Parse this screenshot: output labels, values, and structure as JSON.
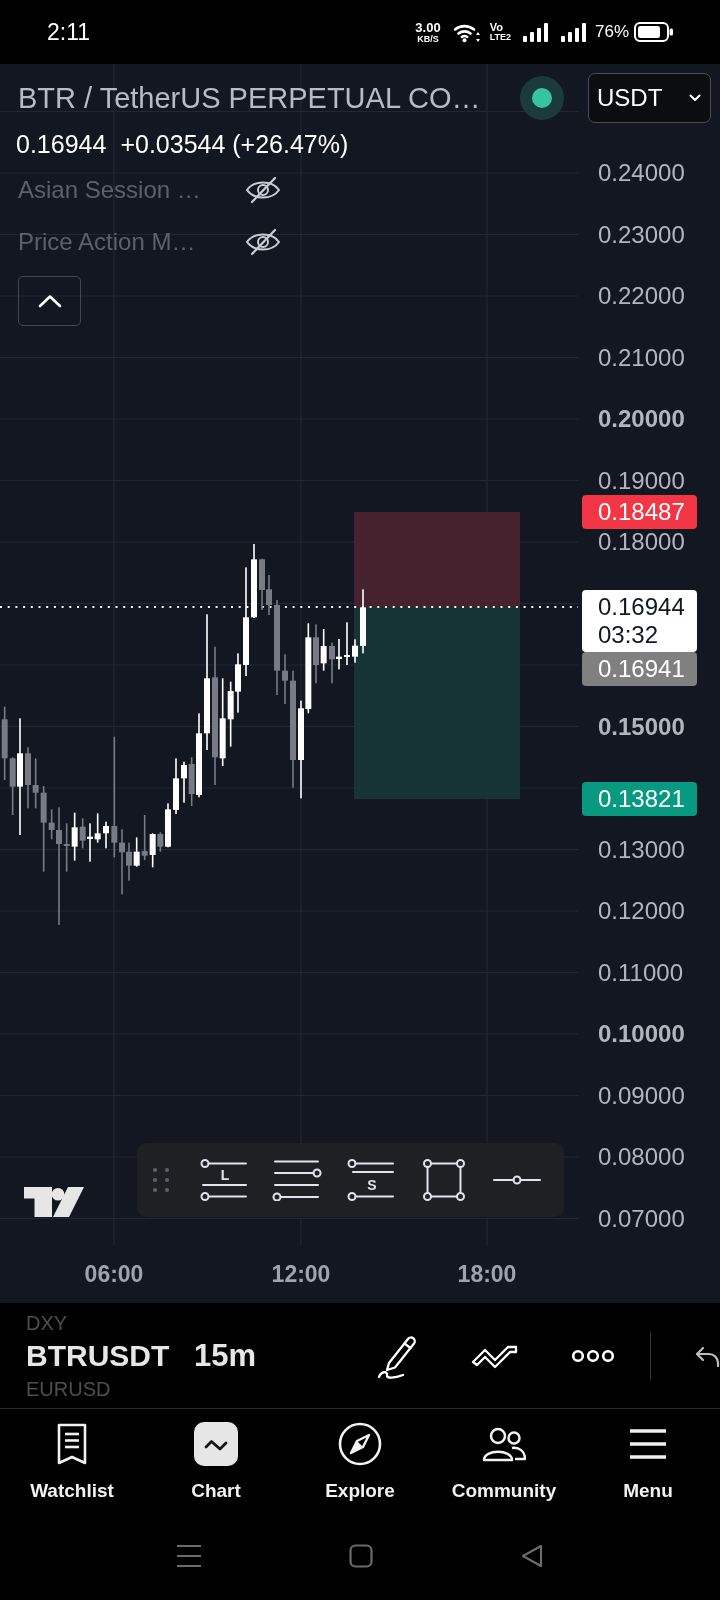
{
  "status_bar": {
    "time": "2:11",
    "speed": {
      "value": "3.00",
      "unit": "KB/S"
    },
    "network": {
      "top": "Vo",
      "bottom": "LTE2"
    },
    "battery": "76%"
  },
  "header": {
    "title": "BTR / TetherUS PERPETUAL CO…",
    "market_open": true,
    "currency": "USDT"
  },
  "quote": {
    "price": "0.16944",
    "change": "+0.03544 (+26.47%)"
  },
  "indicators": [
    {
      "name": "Asian Session …",
      "visible": false
    },
    {
      "name": "Price Action M…",
      "visible": false
    }
  ],
  "price_scale": [
    {
      "label": "0.24000",
      "bold": false
    },
    {
      "label": "0.23000",
      "bold": false
    },
    {
      "label": "0.22000",
      "bold": false
    },
    {
      "label": "0.21000",
      "bold": false
    },
    {
      "label": "0.20000",
      "bold": true
    },
    {
      "label": "0.19000",
      "bold": false
    },
    {
      "label": "0.18000",
      "bold": false
    },
    {
      "label": "0.15000",
      "bold": true
    },
    {
      "label": "0.13000",
      "bold": false
    },
    {
      "label": "0.12000",
      "bold": false
    },
    {
      "label": "0.11000",
      "bold": false
    },
    {
      "label": "0.10000",
      "bold": true
    },
    {
      "label": "0.09000",
      "bold": false
    },
    {
      "label": "0.08000",
      "bold": false
    },
    {
      "label": "0.07000",
      "bold": false
    }
  ],
  "price_markers": [
    {
      "value": "0.18487",
      "color": "#f23645"
    },
    {
      "value": "0.16944",
      "countdown": "03:32",
      "color": "#ffffff"
    },
    {
      "value": "0.16941",
      "color": "#808080"
    },
    {
      "value": "0.13821",
      "color": "#089981"
    }
  ],
  "time_scale": [
    "06:00",
    "12:00",
    "18:00"
  ],
  "drawing_toolbar": [
    {
      "kind": "long-position",
      "label": "L"
    },
    {
      "kind": "parallel-lines"
    },
    {
      "kind": "short-position",
      "label": "S"
    },
    {
      "kind": "rectangle"
    },
    {
      "kind": "horizontal-line"
    }
  ],
  "symbol_bar": {
    "symbols": [
      {
        "symbol": "DXY",
        "selected": false
      },
      {
        "symbol": "BTRUSDT",
        "selected": true
      },
      {
        "symbol": "EURUSD",
        "selected": false
      }
    ],
    "interval": "15m"
  },
  "tab_bar": [
    {
      "label": "Watchlist",
      "selected": false
    },
    {
      "label": "Chart",
      "selected": true
    },
    {
      "label": "Explore",
      "selected": false
    },
    {
      "label": "Community",
      "selected": false
    },
    {
      "label": "Menu",
      "selected": false
    }
  ]
}
